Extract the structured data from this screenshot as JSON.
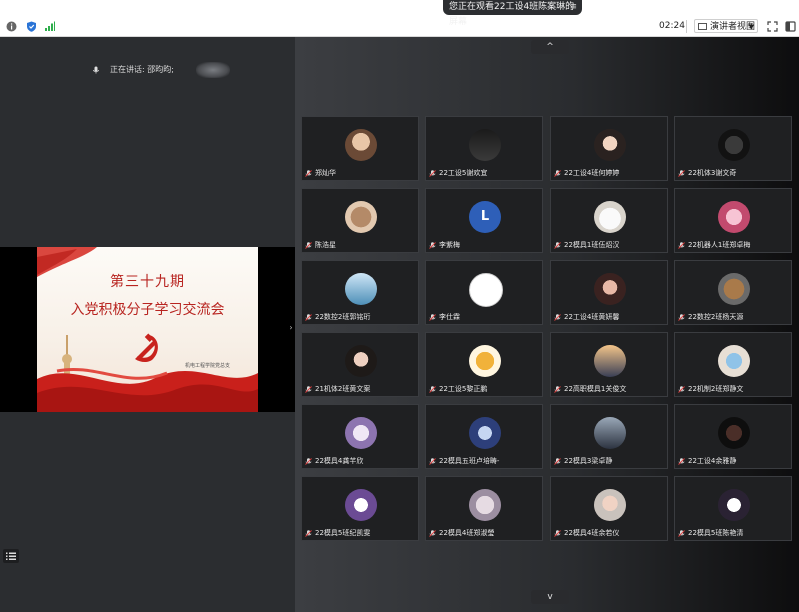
{
  "banner": {
    "text": "您正在观看22工设4班陈案琳的屏幕"
  },
  "toolbar": {
    "time": "02:24",
    "view_label": "演讲者视图"
  },
  "speaker": {
    "label": "正在讲话: 邵昀昀;"
  },
  "slide": {
    "line1": "第三十九期",
    "line2": "入党积极分子学习交流会",
    "org": "机电工程学院党总支"
  },
  "nav": {
    "up": "^",
    "down": "v"
  },
  "colors": {
    "accent": "#b82420",
    "tile_bg": "#1f2022"
  },
  "participants": [
    {
      "name": "郑灿华",
      "avatar": "portrait-avatar"
    },
    {
      "name": "22工设5谢欢宜",
      "avatar": "swing-avatar"
    },
    {
      "name": "22工设4班何婷婷",
      "avatar": "girl-avatar"
    },
    {
      "name": "22机体3谢文奇",
      "avatar": "dark-avatar"
    },
    {
      "name": "陈浩星",
      "avatar": "bear-avatar"
    },
    {
      "name": "李紫梅",
      "avatar": "letter-avatar",
      "letter": "L"
    },
    {
      "name": "22模具1班伍炤汉",
      "avatar": "puppy-avatar"
    },
    {
      "name": "22机器人1班郑卓梅",
      "avatar": "anime-avatar"
    },
    {
      "name": "22数控2班郭铭珩",
      "avatar": "sky-avatar"
    },
    {
      "name": "李仕霖",
      "avatar": "sketch-avatar"
    },
    {
      "name": "22工设4班黄妍馨",
      "avatar": "selfie-avatar"
    },
    {
      "name": "22数控2班杨天源",
      "avatar": "teddy-avatar"
    },
    {
      "name": "21机体2班黄文案",
      "avatar": "girl2-avatar"
    },
    {
      "name": "22工设5黎正鹏",
      "avatar": "food-avatar"
    },
    {
      "name": "22高职模具1关俊文",
      "avatar": "sunset-avatar"
    },
    {
      "name": "22机制2班郑静文",
      "avatar": "cartoon-avatar"
    },
    {
      "name": "22模具4龚芊欣",
      "avatar": "purple-avatar"
    },
    {
      "name": "22模具五班卢培畴-",
      "avatar": "blue-avatar"
    },
    {
      "name": "22模具3梁卓静",
      "avatar": "person-avatar"
    },
    {
      "name": "22工设4余雅静",
      "avatar": "darkface-avatar"
    },
    {
      "name": "22模具5班纪凯雯",
      "avatar": "kuromi-avatar"
    },
    {
      "name": "22模具4班郑淑瑩",
      "avatar": "pale-avatar"
    },
    {
      "name": "22模具4班余若仪",
      "avatar": "woman-avatar"
    },
    {
      "name": "22模具5班陈艳清",
      "avatar": "kuromi2-avatar"
    }
  ]
}
